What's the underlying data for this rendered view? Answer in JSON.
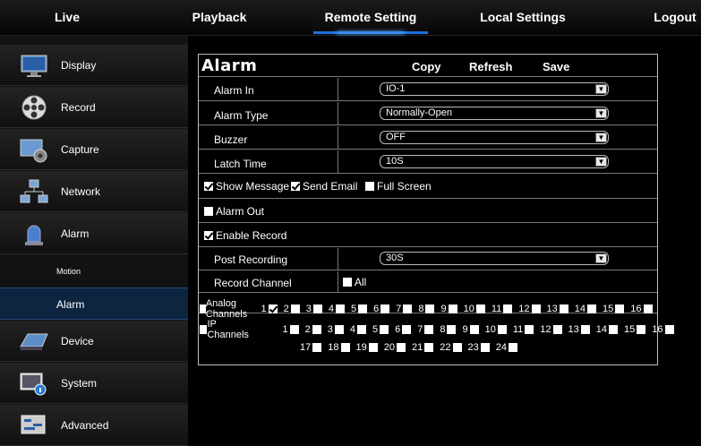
{
  "topnav": {
    "live": "Live",
    "playback": "Playback",
    "remote_setting": "Remote Setting",
    "local_settings": "Local Settings",
    "logout": "Logout"
  },
  "sidebar": {
    "items": [
      {
        "label": "Display",
        "icon": "monitor-icon"
      },
      {
        "label": "Record",
        "icon": "film-reel-icon"
      },
      {
        "label": "Capture",
        "icon": "capture-gear-icon"
      },
      {
        "label": "Network",
        "icon": "network-icon"
      },
      {
        "label": "Alarm",
        "icon": "alarm-siren-icon"
      },
      {
        "label": "Device",
        "icon": "hard-drive-icon"
      },
      {
        "label": "System",
        "icon": "system-info-icon"
      },
      {
        "label": "Advanced",
        "icon": "advanced-icon"
      }
    ],
    "subitems": [
      {
        "label": "Motion"
      },
      {
        "label": "Alarm",
        "selected": true
      }
    ]
  },
  "panel": {
    "title": "Alarm",
    "copy": "Copy",
    "refresh": "Refresh",
    "save": "Save",
    "alarm_in": {
      "label": "Alarm In",
      "value": "IO-1"
    },
    "alarm_type": {
      "label": "Alarm Type",
      "value": "Normally-Open"
    },
    "buzzer": {
      "label": "Buzzer",
      "value": "OFF"
    },
    "latch_time": {
      "label": "Latch Time",
      "value": "10S"
    },
    "show_message": {
      "label": "Show Message",
      "checked": true
    },
    "send_email": {
      "label": "Send Email",
      "checked": true
    },
    "full_screen": {
      "label": "Full Screen",
      "checked": false
    },
    "alarm_out": {
      "label": "Alarm Out",
      "checked": false
    },
    "enable_record": {
      "label": "Enable Record",
      "checked": true
    },
    "post_recording": {
      "label": "Post Recording",
      "value": "30S"
    },
    "record_channel": {
      "label": "Record Channel",
      "all_label": "All",
      "all_checked": false
    },
    "analog_channels": {
      "label": "Analog Channels",
      "checked_all": false,
      "channels": [
        "1",
        "2",
        "3",
        "4",
        "5",
        "6",
        "7",
        "8",
        "9",
        "10",
        "11",
        "12",
        "13",
        "14",
        "15",
        "16"
      ],
      "checked": [
        true,
        false,
        false,
        false,
        false,
        false,
        false,
        false,
        false,
        false,
        false,
        false,
        false,
        false,
        false,
        false
      ]
    },
    "ip_channels": {
      "label": "IP Channels",
      "checked_all": false,
      "channels": [
        "1",
        "2",
        "3",
        "4",
        "5",
        "6",
        "7",
        "8",
        "9",
        "10",
        "11",
        "12",
        "13",
        "14",
        "15",
        "16"
      ],
      "channels2": [
        "17",
        "18",
        "19",
        "20",
        "21",
        "22",
        "23",
        "24"
      ]
    }
  },
  "colors": {
    "accent": "#1e6fdc",
    "selected_bg": "#0e2540"
  }
}
